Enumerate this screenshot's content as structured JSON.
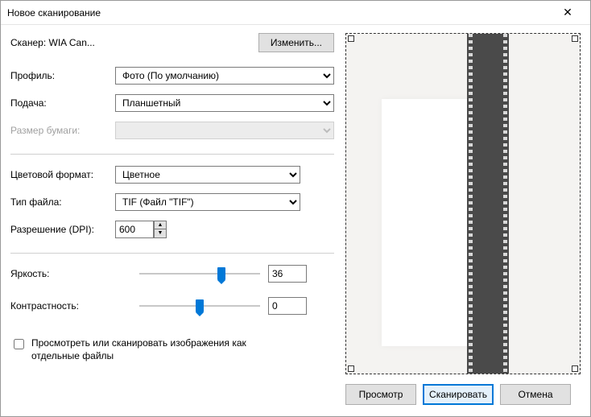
{
  "window": {
    "title": "Новое сканирование"
  },
  "scanner": {
    "prefix": "Сканер:",
    "name": "WIA Can...",
    "change_btn": "Изменить..."
  },
  "labels": {
    "profile": "Профиль:",
    "feed": "Подача:",
    "paper_size": "Размер бумаги:",
    "color_format": "Цветовой формат:",
    "file_type": "Тип файла:",
    "resolution": "Разрешение (DPI):",
    "brightness": "Яркость:",
    "contrast": "Контрастность:"
  },
  "values": {
    "profile": "Фото (По умолчанию)",
    "feed": "Планшетный",
    "paper_size": "",
    "color_format": "Цветное",
    "file_type": "TIF (Файл \"TIF\")",
    "resolution": "600",
    "brightness": "36",
    "contrast": "0"
  },
  "sliders": {
    "brightness_pct": 68,
    "contrast_pct": 50
  },
  "checkbox": {
    "separate_files": "Просмотреть или сканировать изображения как отдельные файлы",
    "checked": false
  },
  "footer": {
    "preview": "Просмотр",
    "scan": "Сканировать",
    "cancel": "Отмена"
  }
}
